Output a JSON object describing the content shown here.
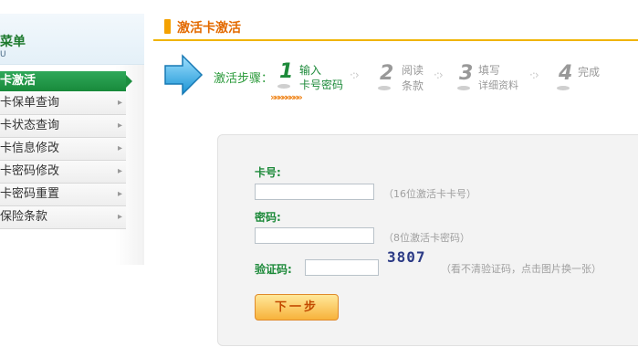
{
  "sidebar": {
    "title": "菜单",
    "subtitle": "U",
    "active_item": "卡激活",
    "items": [
      {
        "label": "卡保单查询"
      },
      {
        "label": "卡状态查询"
      },
      {
        "label": "卡信息修改"
      },
      {
        "label": "卡密码修改"
      },
      {
        "label": "卡密码重置"
      },
      {
        "label": "保险条款"
      }
    ]
  },
  "page": {
    "title": "激活卡激活"
  },
  "steps": {
    "label": "激活步骤：",
    "items": [
      {
        "num": "1",
        "line1": "输入",
        "line2": "卡号密码",
        "active": true
      },
      {
        "num": "2",
        "line1": "阅读",
        "line2": "条款",
        "active": false
      },
      {
        "num": "3",
        "line1": "填写",
        "line2": "详细资料",
        "active": false
      },
      {
        "num": "4",
        "line1": "完成",
        "line2": "",
        "active": false
      }
    ],
    "dots": "·:›",
    "progress_chevrons": "»»»»»»»»"
  },
  "form": {
    "card_label": "卡号:",
    "card_value": "",
    "card_hint": "（16位激活卡卡号）",
    "pwd_label": "密码:",
    "pwd_value": "",
    "pwd_hint": "（8位激活卡密码）",
    "captcha_label": "验证码:",
    "captcha_value": "",
    "captcha_image_text": "3807",
    "captcha_hint": "（看不清验证码，点击图片换一张）",
    "next_label": "下一步"
  },
  "colors": {
    "accent_green": "#1d8a3a",
    "accent_orange": "#e36a00",
    "header_rule": "#f0b400"
  }
}
